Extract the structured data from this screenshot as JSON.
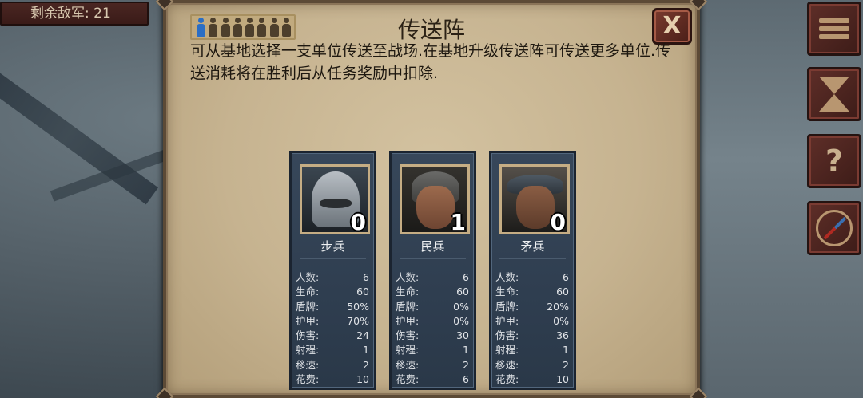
{
  "hud": {
    "enemy_remaining": "剩余敌军: 21"
  },
  "side_buttons": [
    {
      "icon": "menu-icon"
    },
    {
      "icon": "hourglass-icon"
    },
    {
      "icon": "help-icon",
      "label": "?"
    },
    {
      "icon": "compass-icon"
    }
  ],
  "panel": {
    "title": "传送阵",
    "close_label": "X",
    "description": "可从基地选择一支单位传送至战场.在基地升级传送阵可传送更多单位.传送消耗将在胜利后从任务奖励中扣除.",
    "capacity": {
      "filled": 1,
      "total": 8
    }
  },
  "colors": {
    "slot_filled": "#2a6ec4",
    "card_bg": "#37475a",
    "panel_bg": "#c6b390"
  },
  "units": [
    {
      "name": "步兵",
      "count": "0",
      "portrait": "infantry-portrait",
      "stats": [
        {
          "label": "人数:",
          "value": "6"
        },
        {
          "label": "生命:",
          "value": "60"
        },
        {
          "label": "盾牌:",
          "value": "50%"
        },
        {
          "label": "护甲:",
          "value": "70%"
        },
        {
          "label": "伤害:",
          "value": "24"
        },
        {
          "label": "射程:",
          "value": "1"
        },
        {
          "label": "移速:",
          "value": "2"
        },
        {
          "label": "花费:",
          "value": "10"
        }
      ]
    },
    {
      "name": "民兵",
      "count": "1",
      "portrait": "militia-portrait",
      "stats": [
        {
          "label": "人数:",
          "value": "6"
        },
        {
          "label": "生命:",
          "value": "60"
        },
        {
          "label": "盾牌:",
          "value": "0%"
        },
        {
          "label": "护甲:",
          "value": "0%"
        },
        {
          "label": "伤害:",
          "value": "30"
        },
        {
          "label": "射程:",
          "value": "1"
        },
        {
          "label": "移速:",
          "value": "2"
        },
        {
          "label": "花费:",
          "value": "6"
        }
      ]
    },
    {
      "name": "矛兵",
      "count": "0",
      "portrait": "pikeman-portrait",
      "stats": [
        {
          "label": "人数:",
          "value": "6"
        },
        {
          "label": "生命:",
          "value": "60"
        },
        {
          "label": "盾牌:",
          "value": "20%"
        },
        {
          "label": "护甲:",
          "value": "0%"
        },
        {
          "label": "伤害:",
          "value": "36"
        },
        {
          "label": "射程:",
          "value": "1"
        },
        {
          "label": "移速:",
          "value": "2"
        },
        {
          "label": "花费:",
          "value": "10"
        }
      ]
    }
  ]
}
